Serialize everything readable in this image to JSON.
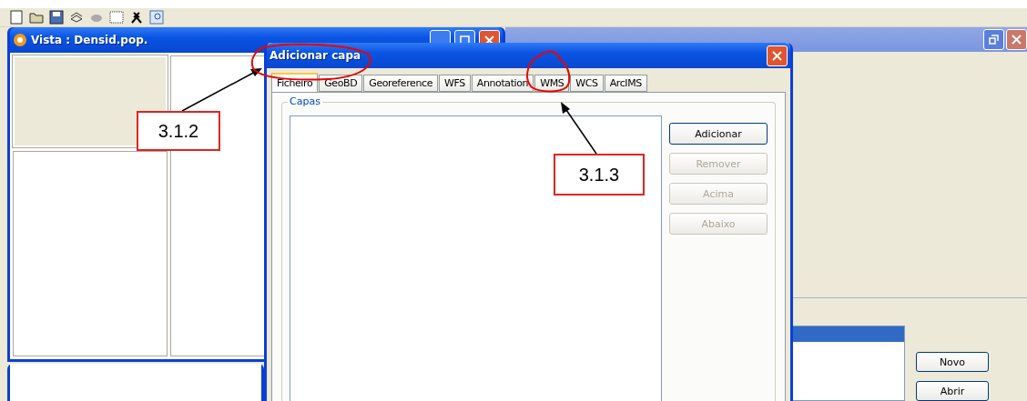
{
  "background_window": {
    "buttons": [
      {
        "label": "Novo"
      },
      {
        "label": "Abrir"
      }
    ]
  },
  "view_window": {
    "title": "Vista : Densid.pop."
  },
  "dialog": {
    "title": "Adicionar capa",
    "tabs": [
      {
        "label": "Ficheiro",
        "selected": true
      },
      {
        "label": "GeoBD",
        "selected": false
      },
      {
        "label": "Georeference",
        "selected": false
      },
      {
        "label": "WFS",
        "selected": false
      },
      {
        "label": "Annotation",
        "selected": false
      },
      {
        "label": "WMS",
        "selected": false
      },
      {
        "label": "WCS",
        "selected": false
      },
      {
        "label": "ArcIMS",
        "selected": false
      }
    ],
    "group_label": "Capas",
    "buttons": [
      {
        "label": "Adicionar",
        "disabled": false
      },
      {
        "label": "Remover",
        "disabled": true
      },
      {
        "label": "Acima",
        "disabled": true
      },
      {
        "label": "Abaixo",
        "disabled": true
      }
    ]
  },
  "annotations": [
    {
      "label": "3.1.2"
    },
    {
      "label": "3.1.3"
    }
  ]
}
